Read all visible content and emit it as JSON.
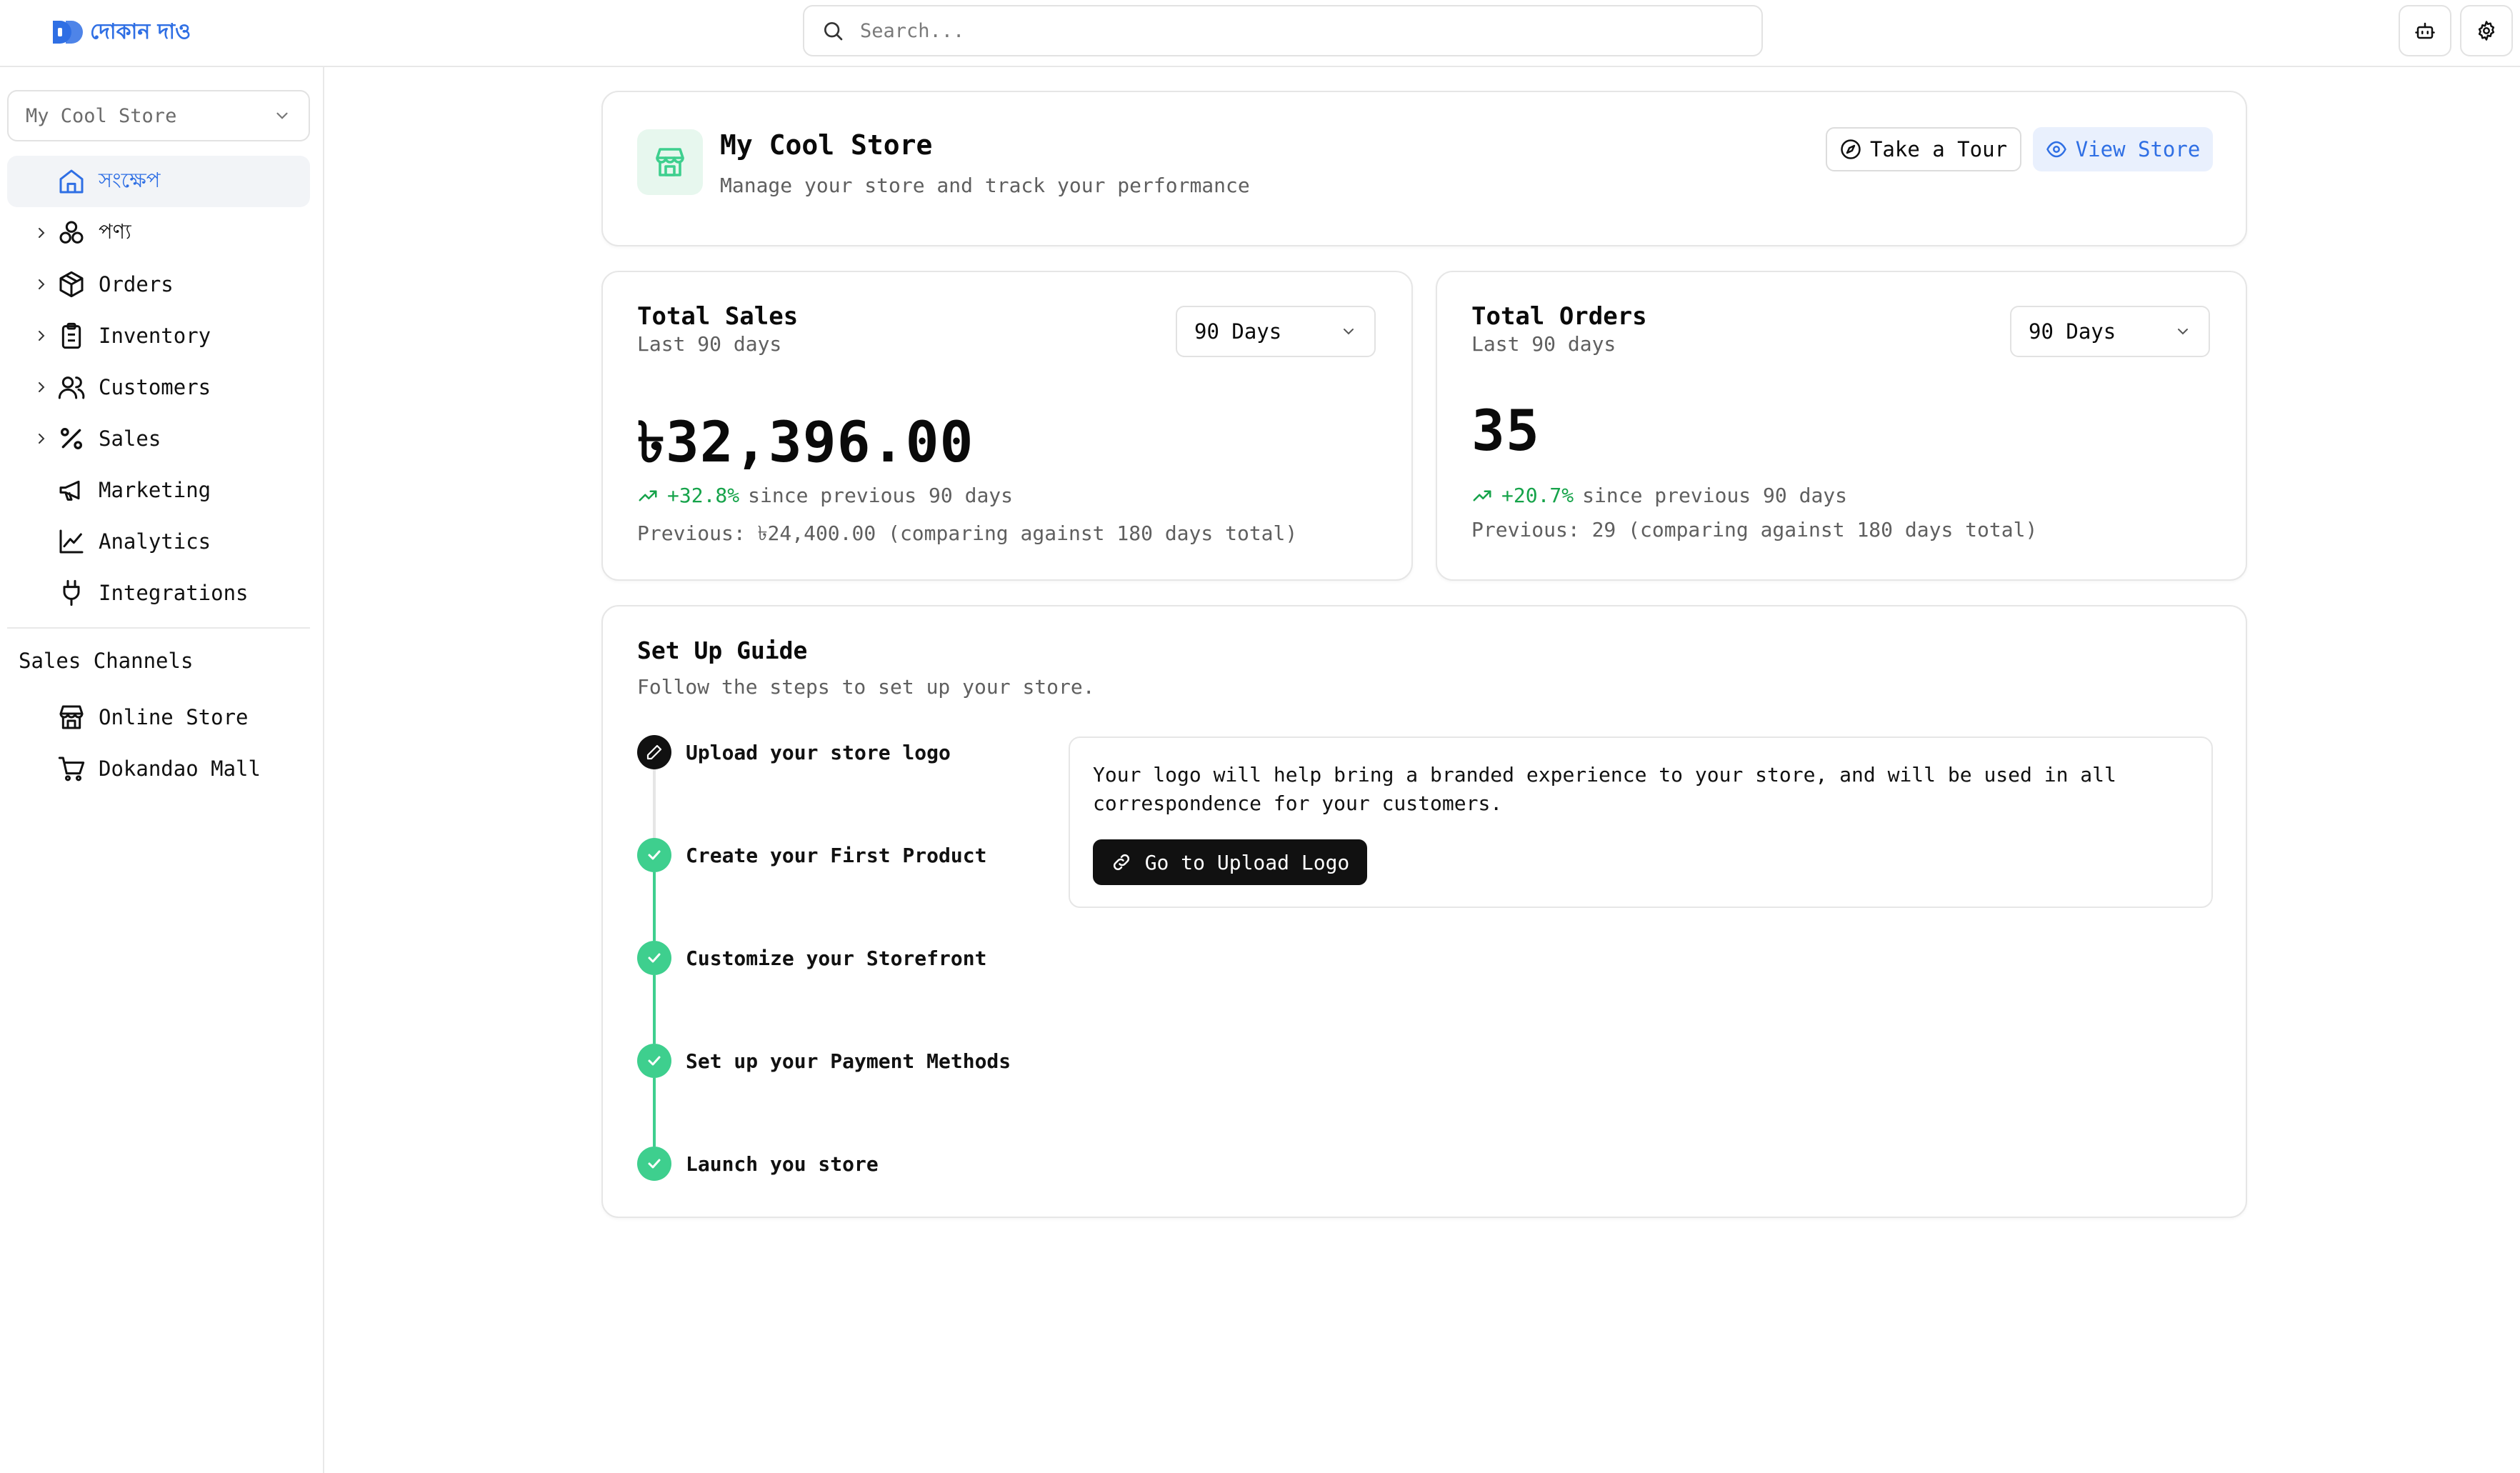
{
  "app": {
    "logo_text": "দোকান দাও"
  },
  "search": {
    "placeholder": "Search..."
  },
  "sidebar": {
    "store_selector": "My Cool Store",
    "items": [
      {
        "label": "সংক্ষেপ",
        "icon": "home-icon",
        "active": true,
        "expandable": false
      },
      {
        "label": "পণ্য",
        "icon": "boxes-icon",
        "expandable": true
      },
      {
        "label": "Orders",
        "icon": "package-icon",
        "expandable": true
      },
      {
        "label": "Inventory",
        "icon": "clipboard-icon",
        "expandable": true
      },
      {
        "label": "Customers",
        "icon": "users-icon",
        "expandable": true
      },
      {
        "label": "Sales",
        "icon": "percent-icon",
        "expandable": true
      },
      {
        "label": "Marketing",
        "icon": "megaphone-icon",
        "expandable": false
      },
      {
        "label": "Analytics",
        "icon": "line-chart-icon",
        "expandable": false
      },
      {
        "label": "Integrations",
        "icon": "plug-icon",
        "expandable": false
      }
    ],
    "channels_heading": "Sales Channels",
    "channels": [
      {
        "label": "Online Store",
        "icon": "store-icon"
      },
      {
        "label": "Dokandao Mall",
        "icon": "cart-icon"
      }
    ]
  },
  "store": {
    "title": "My Cool Store",
    "subtitle": "Manage your store and track your performance",
    "tour_label": "Take a Tour",
    "view_label": "View Store"
  },
  "sales": {
    "title": "Total Sales",
    "subtitle": "Last 90 days",
    "range": "90 Days",
    "value": "৳32,396.00",
    "change": "+32.8%",
    "change_suffix": "since previous 90 days",
    "previous": "Previous: ৳24,400.00 (comparing against 180 days total)"
  },
  "orders": {
    "title": "Total Orders",
    "subtitle": "Last 90 days",
    "range": "90 Days",
    "value": "35",
    "change": "+20.7%",
    "change_suffix": "since previous 90 days",
    "previous": "Previous: 29 (comparing against 180 days total)"
  },
  "guide": {
    "title": "Set Up Guide",
    "subtitle": "Follow the steps to set up your store.",
    "steps": [
      {
        "label": "Upload your store logo",
        "status": "current"
      },
      {
        "label": "Create your First Product",
        "status": "done"
      },
      {
        "label": "Customize your Storefront",
        "status": "done"
      },
      {
        "label": "Set up your Payment Methods",
        "status": "done"
      },
      {
        "label": "Launch you store",
        "status": "done"
      }
    ],
    "detail_text": "Your logo will help bring a branded experience to your store, and will be used in all correspondence for your customers.",
    "detail_button": "Go to Upload Logo"
  },
  "colors": {
    "accent": "#2f6fe4",
    "success": "#3ecf8e",
    "positive_text": "#16a34a"
  }
}
